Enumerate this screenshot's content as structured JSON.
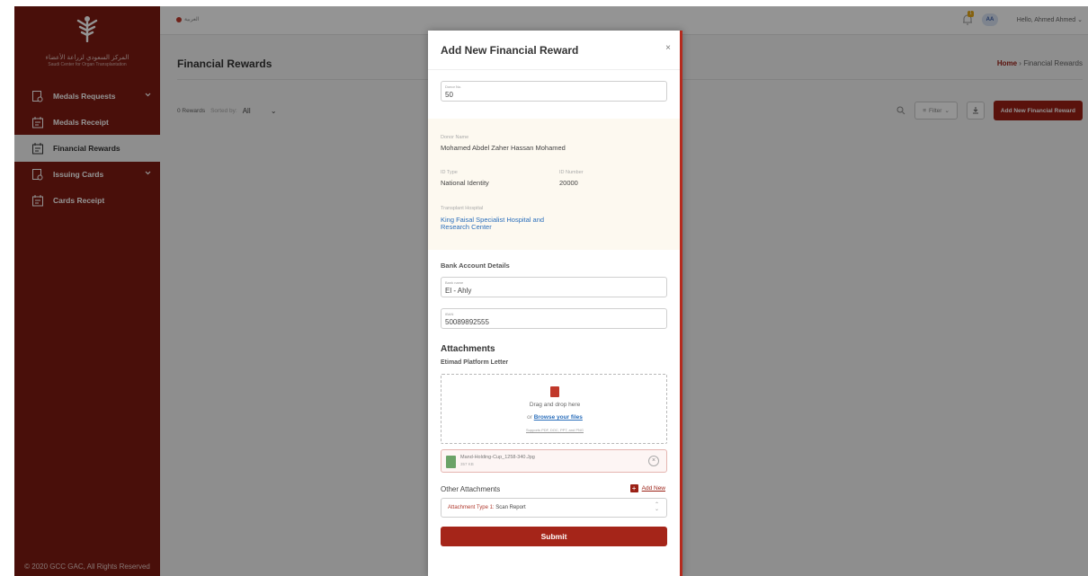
{
  "sidebar": {
    "org_name_ar": "المركز السعودي لزراعة الأعضاء",
    "org_name_en": "Saudi Center for Organ Transplantation",
    "items": [
      {
        "label": "Medals Requests",
        "has_children": true,
        "icon": "medal-request-icon"
      },
      {
        "label": "Medals Receipt",
        "has_children": false,
        "icon": "receipt-icon"
      },
      {
        "label": "Financial Rewards",
        "has_children": false,
        "icon": "reward-icon",
        "active": true
      },
      {
        "label": "Issuing Cards",
        "has_children": true,
        "icon": "card-issue-icon"
      },
      {
        "label": "Cards Receipt",
        "has_children": false,
        "icon": "card-receipt-icon"
      }
    ],
    "footer": "© 2020 GCC GAC, All Rights Reserved"
  },
  "topbar": {
    "language": "العربية",
    "notification_count": "1",
    "avatar_initials": "AA",
    "greeting": "Hello, Ahmed Ahmed"
  },
  "page": {
    "title": "Financial Rewards",
    "breadcrumb_home": "Home",
    "breadcrumb_sep": "›",
    "breadcrumb_current": "Financial Rewards",
    "rewards_count": "0 Rewards",
    "sorted_by_label": "Sorted by:",
    "sorted_by_value": "All",
    "filter_label": "Filter",
    "add_button": "Add New Financial Reward"
  },
  "modal": {
    "title": "Add New Financial Reward",
    "close": "×",
    "donor_no_label": "Donor No.",
    "donor_no_value": "50",
    "donor_name_label": "Donor Name",
    "donor_name_value": "Mohamed Abdel Zaher Hassan Mohamed",
    "id_type_label": "ID Type",
    "id_type_value": "National Identity",
    "id_number_label": "ID Number",
    "id_number_value": "20000",
    "hospital_label": "Transplant Hospital",
    "hospital_value_line1": "King Faisal Specialist Hospital and",
    "hospital_value_line2": "Research Center",
    "bank_section": "Bank Account Details",
    "bank_name_label": "Bank name",
    "bank_name_value": "El - Ahly",
    "iban_label": "IBAN",
    "iban_value": "50089892555",
    "attachments_title": "Attachments",
    "etimad_label": "Etimad Platform Letter",
    "drop_text": "Drag and drop here",
    "or_text": "or",
    "browse_text": "Browse your files",
    "supports_text": "Supports PDF, DOC, PPT, and PNG",
    "file_name": "Mand-Holding-Cup_1258-340.Jpg",
    "file_size": "357 KB",
    "other_attachments": "Other Attachments",
    "add_new": "Add New",
    "attachment_type_label": "Attachment Type 1:",
    "attachment_type_value": "Scan Report",
    "submit": "Submit"
  },
  "colors": {
    "sidebar": "#7e1b12",
    "accent": "#9b2015",
    "link": "#2a6ebb"
  }
}
